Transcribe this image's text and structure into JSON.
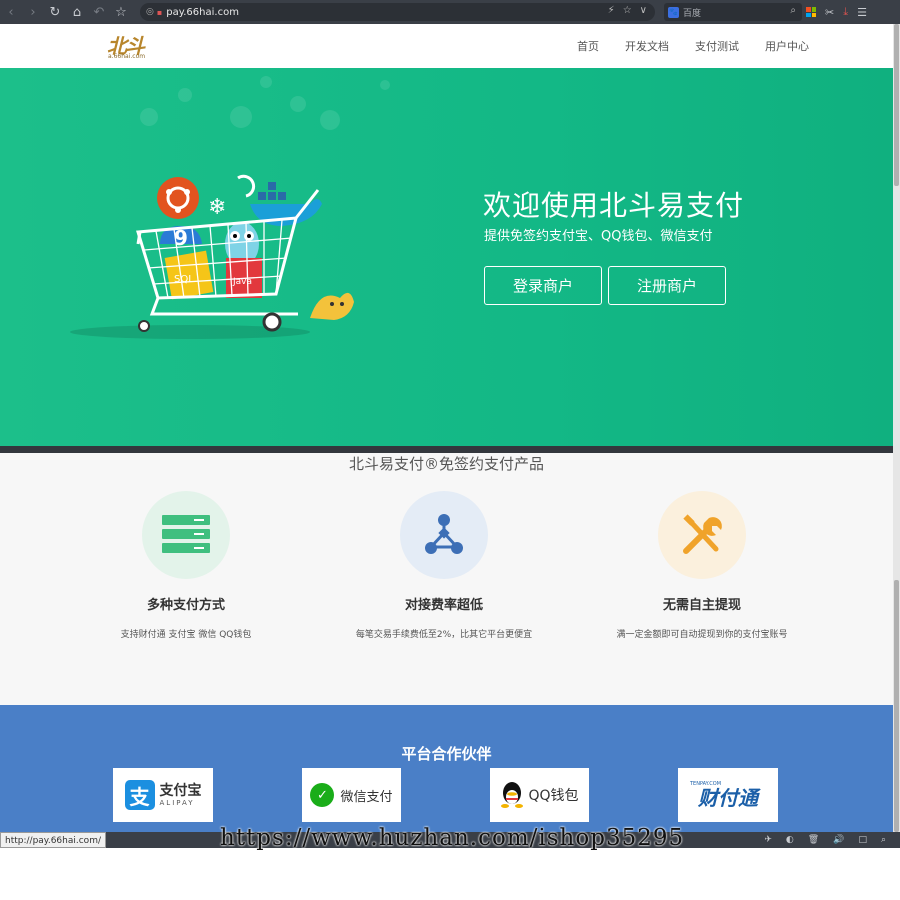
{
  "browser": {
    "url": "pay.66hai.com",
    "search_placeholder": "百度",
    "status_url": "http://pay.66hai.com/"
  },
  "site": {
    "logo_text": "北斗",
    "logo_sub": "a.66hai.com",
    "nav": [
      "首页",
      "开发文档",
      "支付测试",
      "用户中心"
    ]
  },
  "hero": {
    "title": "欢迎使用北斗易支付",
    "subtitle": "提供免签约支付宝、QQ钱包、微信支付",
    "buttons": [
      "登录商户",
      "注册商户"
    ],
    "background": "#1cbf8a"
  },
  "products": {
    "title": "北斗易支付®免签约支付产品",
    "features": [
      {
        "title": "多种支付方式",
        "desc": "支持财付通 支付宝 微信 QQ钱包",
        "icon": "server-stack-icon",
        "color": "#3fbf7f"
      },
      {
        "title": "对接费率超低",
        "desc": "每笔交易手续费低至2%，比其它平台更便宜",
        "icon": "network-nodes-icon",
        "color": "#3d6fb6"
      },
      {
        "title": "无需自主提现",
        "desc": "满一定金额即可自动提现到你的支付宝账号",
        "icon": "tools-icon",
        "color": "#f0a32a"
      }
    ]
  },
  "partners": {
    "title": "平台合作伙伴",
    "items": [
      {
        "name": "支付宝",
        "sub": "ALIPAY"
      },
      {
        "name": "微信支付"
      },
      {
        "name": "QQ钱包"
      },
      {
        "name": "财付通",
        "sub": "TENPAY.COM"
      }
    ],
    "background": "#4a7fc7"
  },
  "watermark": "https://www.huzhan.com/ishop35295"
}
